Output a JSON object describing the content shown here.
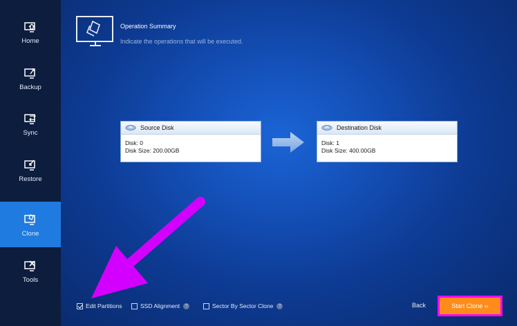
{
  "sidebar": {
    "items": [
      {
        "label": "Home",
        "icon": "home-icon",
        "active": false
      },
      {
        "label": "Backup",
        "icon": "backup-icon",
        "active": false
      },
      {
        "label": "Sync",
        "icon": "sync-icon",
        "active": false
      },
      {
        "label": "Restore",
        "icon": "restore-icon",
        "active": false
      },
      {
        "label": "Clone",
        "icon": "clone-icon",
        "active": true
      },
      {
        "label": "Tools",
        "icon": "tools-icon",
        "active": false
      }
    ]
  },
  "header": {
    "title": "Operation Summary",
    "subtitle": "Indicate the operations that will be executed."
  },
  "source": {
    "title": "Source Disk",
    "disk": "Disk: 0",
    "size": "Disk Size: 200.00GB"
  },
  "destination": {
    "title": "Destination Disk",
    "disk": "Disk: 1",
    "size": "Disk Size: 400.00GB"
  },
  "options": {
    "edit_partitions": {
      "label": "Edit Partitions",
      "checked": true
    },
    "ssd_alignment": {
      "label": "SSD Alignment",
      "checked": false
    },
    "sector_clone": {
      "label": "Sector By Sector Clone",
      "checked": false
    }
  },
  "footer": {
    "back_label": "Back",
    "start_label": "Start Clone ››"
  },
  "colors": {
    "sidebar_bg": "#0c1d3e",
    "active_nav": "#1f7be0",
    "start_button": "#ff8c1a",
    "highlight": "#ff00ff",
    "annotation_arrow": "#d400ff"
  }
}
